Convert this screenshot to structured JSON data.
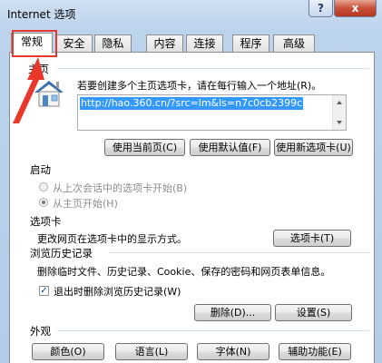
{
  "window": {
    "title": "Internet 选项",
    "help_label": "?",
    "close_label": "x"
  },
  "tabs": [
    "常规",
    "安全",
    "隐私",
    "内容",
    "连接",
    "程序",
    "高级"
  ],
  "home": {
    "group_title": "主页",
    "instruction": "若要创建多个主页选项卡，请在每行输入一个地址(R)。",
    "url": "http://hao.360.cn/?src=lm&ls=n7c0cb2399c",
    "use_current": "使用当前页(C)",
    "use_default": "使用默认值(F)",
    "use_new_tab": "使用新选项卡(U)"
  },
  "startup": {
    "group_title": "启动",
    "option_last_session": "从上次会话中的选项卡开始(B)",
    "option_home": "从主页开始(H)"
  },
  "tabs_section": {
    "group_title": "选项卡",
    "description": "更改网页在选项卡中的显示方式。",
    "button": "选项卡(T)"
  },
  "history": {
    "group_title": "浏览历史记录",
    "description": "删除临时文件、历史记录、Cookie、保存的密码和网页表单信息。",
    "checkbox_label": "退出时删除浏览历史记录(W)",
    "delete_button": "删除(D)...",
    "settings_button": "设置(S)"
  },
  "appearance": {
    "group_title": "外观",
    "colors_button": "颜色(O)",
    "languages_button": "语言(L)",
    "fonts_button": "字体(N)",
    "accessibility_button": "辅助功能(E)"
  },
  "colors": {
    "highlight": "#e8382c",
    "selection": "#3399ff"
  }
}
